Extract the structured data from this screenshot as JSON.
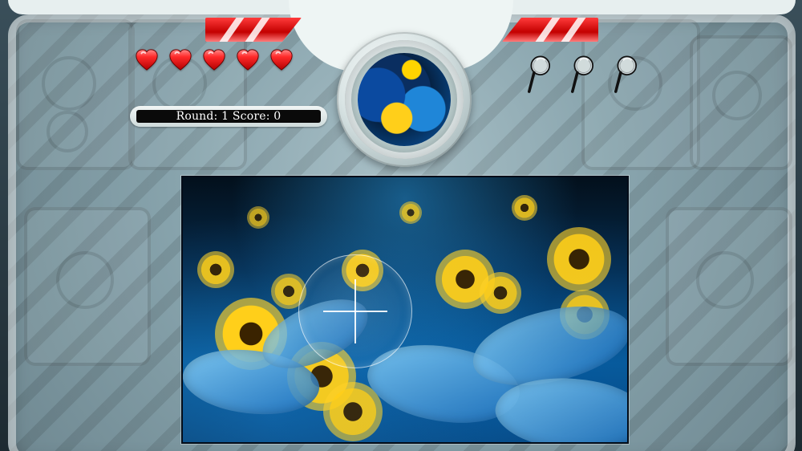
{
  "hud": {
    "score_text": "Round: 1 Score: 0"
  },
  "lives": {
    "total": 5
  },
  "hints": {
    "total": 3
  },
  "colors": {
    "heart": "#ff2b2b",
    "stripe": "#e00000",
    "hud_black": "#0a0a0a"
  },
  "icons": {
    "heart": "heart-icon",
    "magnifier": "magnifying-glass-icon",
    "reticle": "crosshair-reticle"
  }
}
